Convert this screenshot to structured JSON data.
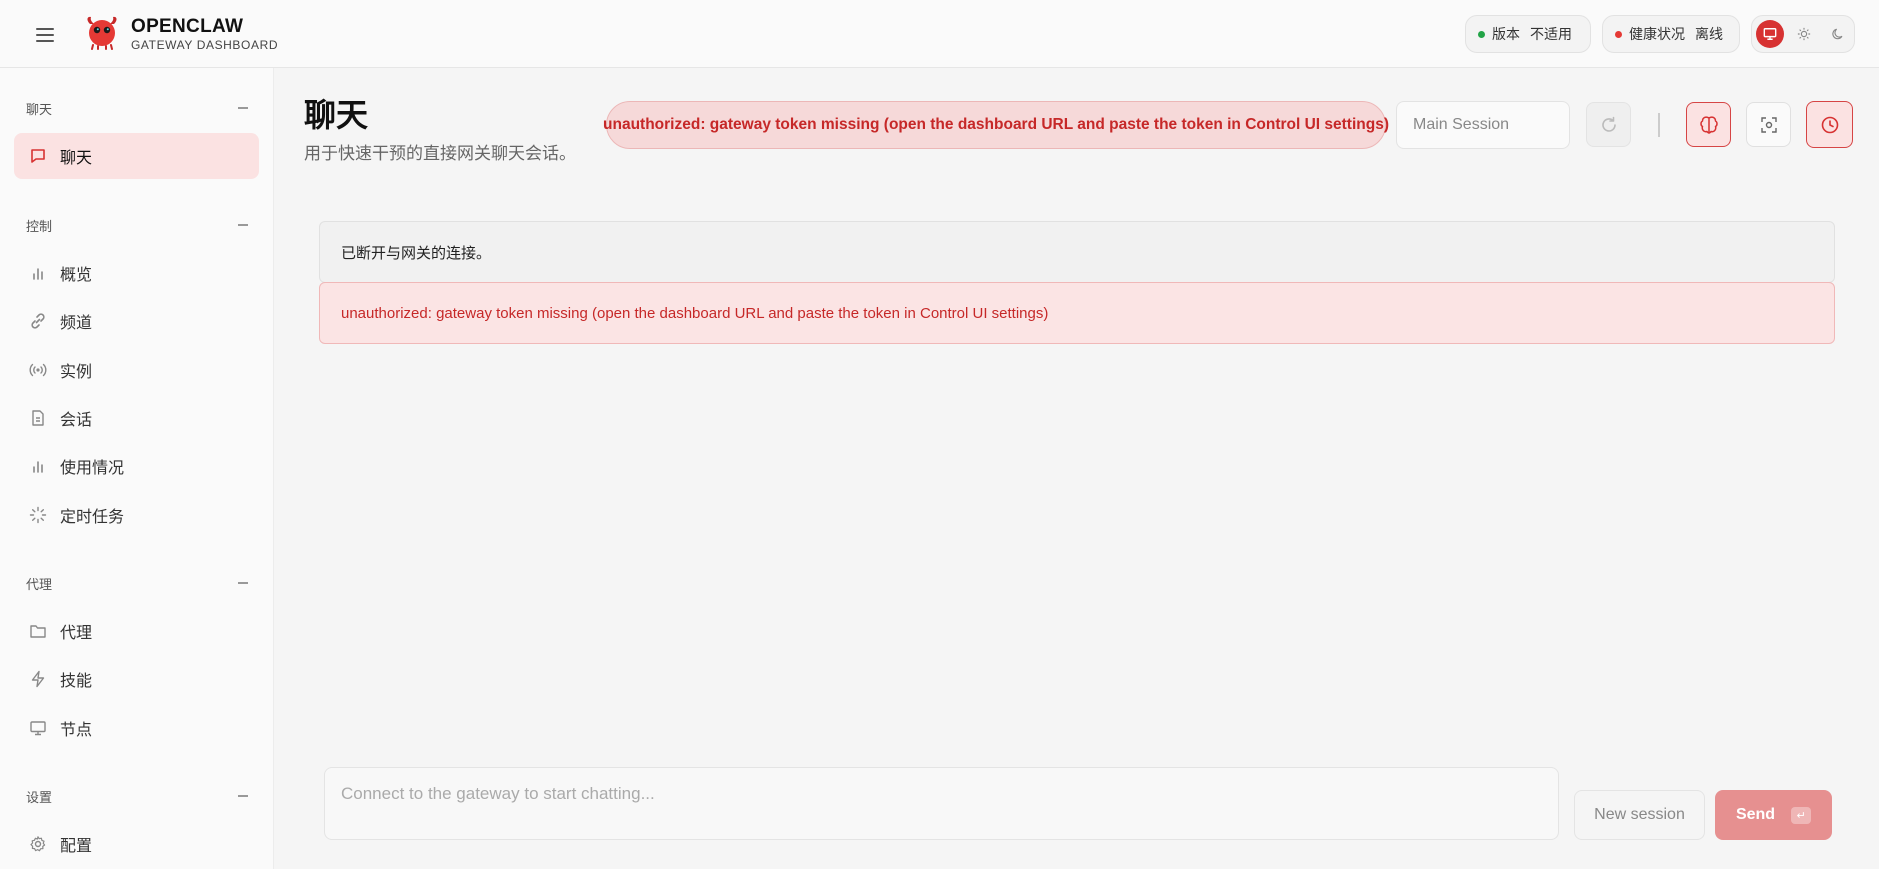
{
  "brand": {
    "title": "OPENCLAW",
    "subtitle": "GATEWAY DASHBOARD"
  },
  "status": {
    "version": {
      "label": "版本",
      "value": "不适用",
      "color": "#22a447"
    },
    "health": {
      "label": "健康状况",
      "value": "离线",
      "color": "#e53935"
    }
  },
  "theme": {
    "options": [
      "monitor-icon",
      "sun-icon",
      "moon-icon"
    ],
    "active": "monitor-icon",
    "accent": "#d73232"
  },
  "sidebar": {
    "sections": [
      {
        "label": "聊天",
        "items": [
          {
            "label": "聊天",
            "icon": "chat-bubble-icon",
            "active": true
          }
        ]
      },
      {
        "label": "控制",
        "items": [
          {
            "label": "概览",
            "icon": "bar-chart-icon"
          },
          {
            "label": "频道",
            "icon": "link-icon"
          },
          {
            "label": "实例",
            "icon": "broadcast-icon"
          },
          {
            "label": "会话",
            "icon": "document-icon"
          },
          {
            "label": "使用情况",
            "icon": "bar-chart-icon"
          },
          {
            "label": "定时任务",
            "icon": "loader-icon"
          }
        ]
      },
      {
        "label": "代理",
        "items": [
          {
            "label": "代理",
            "icon": "folder-icon"
          },
          {
            "label": "技能",
            "icon": "lightning-icon"
          },
          {
            "label": "节点",
            "icon": "monitor-icon"
          }
        ]
      },
      {
        "label": "设置",
        "items": [
          {
            "label": "配置",
            "icon": "gear-icon"
          }
        ]
      }
    ]
  },
  "main": {
    "title": "聊天",
    "subtitle": "用于快速干预的直接网关聊天会话。",
    "error_banner": "unauthorized: gateway token missing (open the dashboard URL and paste the token in Control UI settings)",
    "session_placeholder": "Main Session",
    "messages": [
      {
        "type": "info",
        "text": "已断开与网关的连接。"
      },
      {
        "type": "error",
        "text": "unauthorized: gateway token missing (open the dashboard URL and paste the token in Control UI settings)"
      }
    ],
    "composer_placeholder": "Connect to the gateway to start chatting...",
    "new_session_label": "New session",
    "send_label": "Send",
    "send_hint": "↵"
  }
}
